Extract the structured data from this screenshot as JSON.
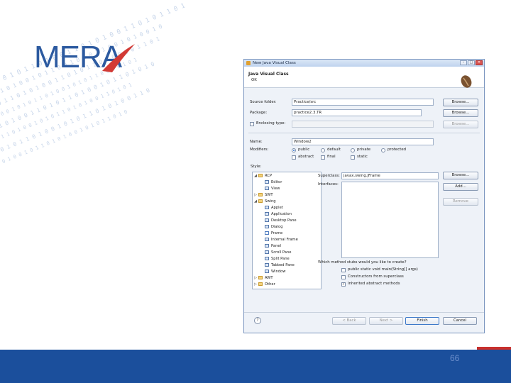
{
  "slide": {
    "logo_text": "MERA",
    "page_number": "66",
    "colors": {
      "brand_blue": "#2c5aa0",
      "footer_blue": "#1b4f9c",
      "accent_red": "#c9302c"
    }
  },
  "window": {
    "title": "New Java Visual Class",
    "controls": {
      "minimize": "–",
      "maximize": "□",
      "close": "✕"
    }
  },
  "header": {
    "title": "Java Visual Class",
    "message": "OK"
  },
  "form": {
    "source_folder_label": "Source folder:",
    "source_folder_value": "Practice/src",
    "package_label": "Package:",
    "package_value": "practice2.3.TR",
    "enclosing_type_label": "Enclosing type:",
    "enclosing_type_value": "",
    "name_label": "Name:",
    "name_value": "Window2",
    "modifiers_label": "Modifiers:",
    "modifiers": [
      {
        "label": "public",
        "selected": true
      },
      {
        "label": "default",
        "selected": false
      },
      {
        "label": "private",
        "selected": false
      },
      {
        "label": "protected",
        "selected": false
      }
    ],
    "modifier_flags": [
      {
        "label": "abstract",
        "checked": false
      },
      {
        "label": "final",
        "checked": false
      },
      {
        "label": "static",
        "checked": false
      }
    ],
    "style_label": "Style:",
    "superclass_label": "Superclass:",
    "superclass_value": "javax.swing.JFrame",
    "interfaces_label": "Interfaces:",
    "stubs_question": "Which method stubs would you like to create?",
    "stubs": [
      {
        "label": "public static void main(String[] args)",
        "checked": false
      },
      {
        "label": "Constructors from superclass",
        "checked": false
      },
      {
        "label": "Inherited abstract methods",
        "checked": true
      }
    ]
  },
  "buttons": {
    "browse_source": "Browse...",
    "browse_package": "Browse...",
    "browse_enclosing": "Browse...",
    "browse_superclass": "Browse...",
    "add": "Add...",
    "remove": "Remove",
    "back": "< Back",
    "next": "Next >",
    "finish": "Finish",
    "cancel": "Cancel"
  },
  "style_tree": [
    {
      "label": "RCP",
      "level": 0,
      "expand": "◢",
      "kind": "folder"
    },
    {
      "label": "Editor",
      "level": 1,
      "expand": "",
      "kind": "item"
    },
    {
      "label": "View",
      "level": 1,
      "expand": "",
      "kind": "item"
    },
    {
      "label": "SWT",
      "level": 0,
      "expand": "▷",
      "kind": "folder"
    },
    {
      "label": "Swing",
      "level": 0,
      "expand": "◢",
      "kind": "folder"
    },
    {
      "label": "Applet",
      "level": 1,
      "expand": "",
      "kind": "item"
    },
    {
      "label": "Application",
      "level": 1,
      "expand": "",
      "kind": "item"
    },
    {
      "label": "Desktop Pane",
      "level": 1,
      "expand": "",
      "kind": "item"
    },
    {
      "label": "Dialog",
      "level": 1,
      "expand": "",
      "kind": "item"
    },
    {
      "label": "Frame",
      "level": 1,
      "expand": "",
      "kind": "sel"
    },
    {
      "label": "Internal Frame",
      "level": 1,
      "expand": "",
      "kind": "item"
    },
    {
      "label": "Panel",
      "level": 1,
      "expand": "",
      "kind": "item"
    },
    {
      "label": "Scroll Pane",
      "level": 1,
      "expand": "",
      "kind": "item"
    },
    {
      "label": "Split Pane",
      "level": 1,
      "expand": "",
      "kind": "item"
    },
    {
      "label": "Tabbed Pane",
      "level": 1,
      "expand": "",
      "kind": "item"
    },
    {
      "label": "Window",
      "level": 1,
      "expand": "",
      "kind": "item"
    },
    {
      "label": "AWT",
      "level": 0,
      "expand": "▷",
      "kind": "folder"
    },
    {
      "label": "Other",
      "level": 0,
      "expand": "▷",
      "kind": "folder"
    }
  ]
}
